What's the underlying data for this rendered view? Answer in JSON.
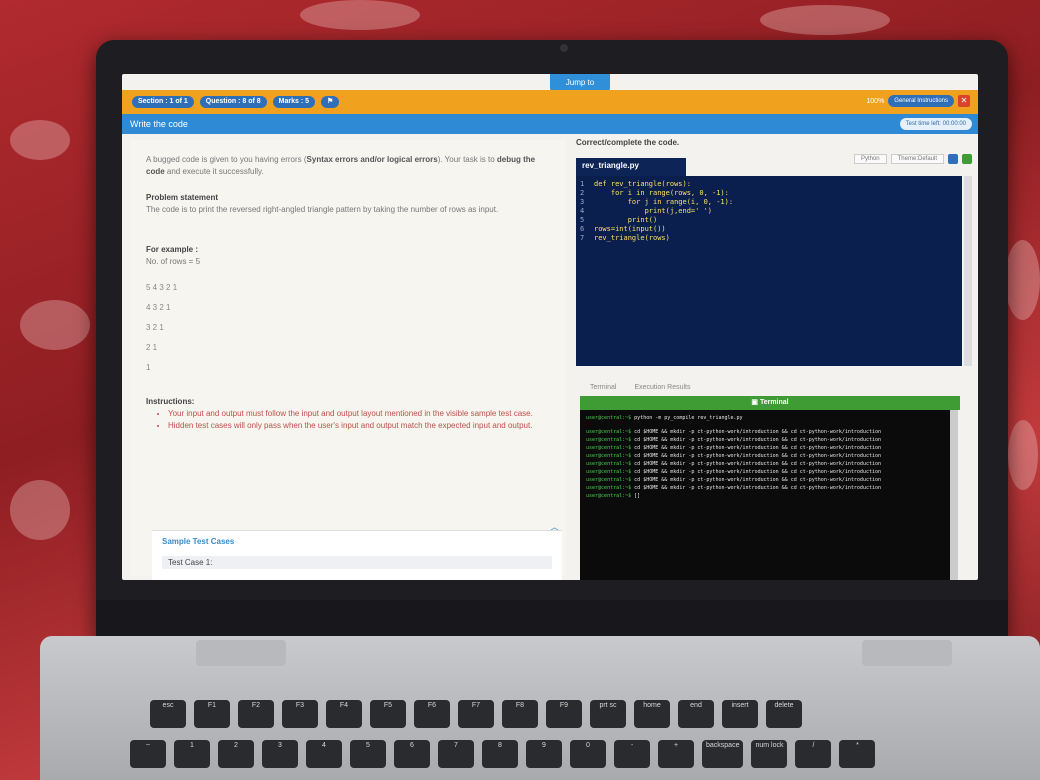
{
  "quiz": {
    "jump_label": "Jump to",
    "section_label": "Section : 1 of 1",
    "question_label": "Question : 8 of 8",
    "marks_label": "Marks : 5",
    "zoom_label": "100%",
    "general_instructions_label": "General Instructions",
    "close_label": "✕",
    "title": "Write the code",
    "time_left_label": "Test time left: 00:00:00"
  },
  "problem": {
    "intro_prefix": "A bugged code is given to you having errors (",
    "intro_bold": "Syntax errors and/or logical errors",
    "intro_mid": "). Your task is to ",
    "intro_bold2": "debug the code",
    "intro_suffix": " and execute it successfully.",
    "statement_heading": "Problem statement",
    "statement_text": "The code is to print the reversed right-angled triangle pattern by taking the number of rows as input.",
    "example_heading": "For example :",
    "example_input": "No. of rows = 5",
    "pattern": [
      "5 4 3 2 1",
      "4 3 2 1",
      "3 2 1",
      "2 1",
      "1"
    ],
    "instructions_heading": "Instructions:",
    "instructions": [
      "Your input and output must follow the input and output layout mentioned in the visible sample test case.",
      "Hidden test cases will only pass when the user's input and output match the expected input and output."
    ],
    "sample_heading": "Sample Test Cases",
    "test_case_label": "Test Case 1:"
  },
  "editor": {
    "heading": "Correct/complete the code.",
    "language": "Python",
    "theme": "Theme:Default",
    "file_name": "rev_triangle.py",
    "lines": [
      "def rev_triangle(rows):",
      "    for i in range(rows, 0, -1):",
      "        for j in range(i, 0, -1):",
      "            print(j,end=' ')",
      "        print()",
      "rows=int(input())",
      "rev_triangle(rows)"
    ]
  },
  "console": {
    "tab_terminal": "Terminal",
    "tab_results": "Execution Results",
    "title": "Terminal",
    "lines": [
      "user@central:~$ python -m py_compile rev_triangle.py",
      "user@central:~$ cd $HOME && mkdir -p ct-python-work/introduction && cd ct-python-work/introduction",
      "user@central:~$ cd $HOME && mkdir -p ct-python-work/introduction && cd ct-python-work/introduction",
      "user@central:~$ cd $HOME && mkdir -p ct-python-work/introduction && cd ct-python-work/introduction",
      "user@central:~$ cd $HOME && mkdir -p ct-python-work/introduction && cd ct-python-work/introduction",
      "user@central:~$ cd $HOME && mkdir -p ct-python-work/introduction && cd ct-python-work/introduction",
      "user@central:~$ cd $HOME && mkdir -p ct-python-work/introduction && cd ct-python-work/introduction",
      "user@central:~$ cd $HOME && mkdir -p ct-python-work/introduction && cd ct-python-work/introduction",
      "user@central:~$ cd $HOME && mkdir -p ct-python-work/introduction && cd ct-python-work/introduction",
      "user@central:~$ []"
    ]
  },
  "keyboard": {
    "row1": [
      "esc",
      "F1",
      "F2",
      "F3",
      "F4",
      "F5",
      "F6",
      "F7",
      "F8",
      "F9",
      "prt sc",
      "home",
      "end",
      "insert",
      "delete"
    ],
    "row2": [
      "~",
      "1",
      "2",
      "3",
      "4",
      "5",
      "6",
      "7",
      "8",
      "9",
      "0",
      "-",
      "+",
      "backspace",
      "num lock",
      "/",
      "*"
    ]
  },
  "colors": {
    "orange_bar": "#f0a21f",
    "blue_bar": "#2e8ad4",
    "editor_bg": "#0a1f4e",
    "terminal_head": "#3f9c35"
  }
}
